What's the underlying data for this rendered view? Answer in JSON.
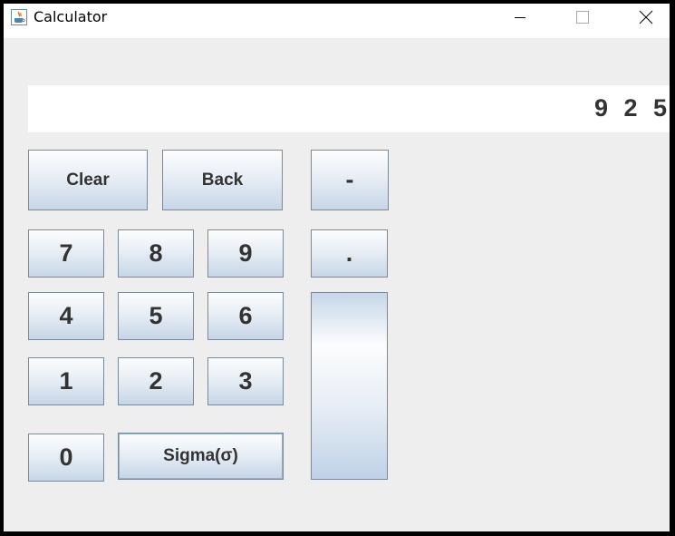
{
  "window": {
    "title": "Calculator",
    "controls": {
      "minimize": "minimize-icon",
      "maximize": "maximize-icon",
      "close": "close-icon"
    }
  },
  "display": {
    "value": "9 2 5"
  },
  "buttons": {
    "clear": "Clear",
    "back": "Back",
    "minus": "-",
    "dot": ".",
    "d7": "7",
    "d8": "8",
    "d9": "9",
    "d4": "4",
    "d5": "5",
    "d6": "6",
    "d1": "1",
    "d2": "2",
    "d3": "3",
    "d0": "0",
    "sigma": "Sigma(σ)",
    "tall": ""
  },
  "colors": {
    "window_bg": "#eeeeee",
    "button_border": "#7a8a99",
    "button_gradient_bottom": "#c6d6e8",
    "text": "#333333"
  }
}
